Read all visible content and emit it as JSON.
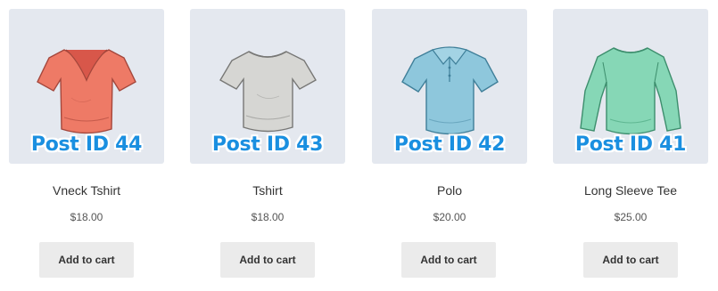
{
  "products": [
    {
      "overlay_label": "Post ID 44",
      "name": "Vneck Tshirt",
      "price": "$18.00",
      "button": "Add to cart",
      "image_icon": "vneck-tshirt-icon",
      "color": "#ee7a66"
    },
    {
      "overlay_label": "Post ID 43",
      "name": "Tshirt",
      "price": "$18.00",
      "button": "Add to cart",
      "image_icon": "tshirt-icon",
      "color": "#cfcfcd"
    },
    {
      "overlay_label": "Post ID 42",
      "name": "Polo",
      "price": "$20.00",
      "button": "Add to cart",
      "image_icon": "polo-shirt-icon",
      "color": "#8ec7dc"
    },
    {
      "overlay_label": "Post ID 41",
      "name": "Long Sleeve Tee",
      "price": "$25.00",
      "button": "Add to cart",
      "image_icon": "long-sleeve-tee-icon",
      "color": "#86d7b6"
    }
  ]
}
